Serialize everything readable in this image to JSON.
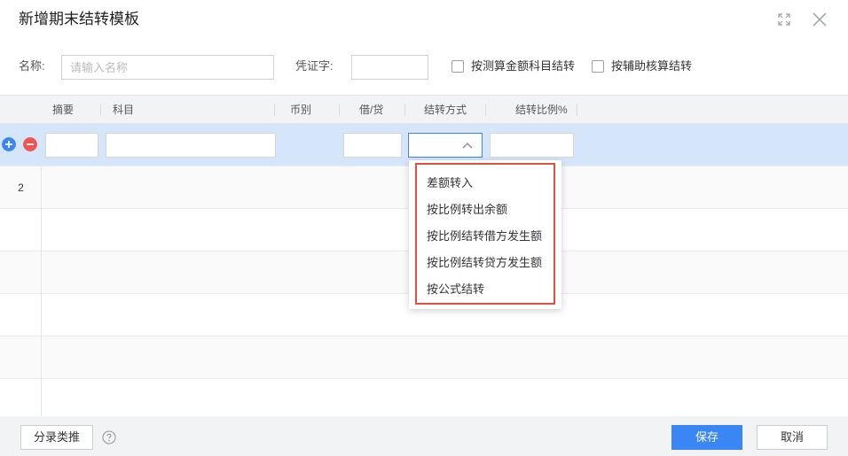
{
  "dialog": {
    "title": "新增期末结转模板",
    "expand_icon": "expand-icon",
    "close_icon": "close-icon"
  },
  "form": {
    "name_label": "名称:",
    "name_placeholder": "请输入名称",
    "name_value": "",
    "voucher_label": "凭证字:",
    "voucher_value": "",
    "check_measure_label": "按测算金额科目结转",
    "check_measure_checked": false,
    "check_aux_label": "按辅助核算结转",
    "check_aux_checked": false
  },
  "grid": {
    "columns": [
      "摘要",
      "科目",
      "币别",
      "借/贷",
      "结转方式",
      "结转比例%"
    ],
    "rows": [
      {
        "num": "",
        "selected": true
      },
      {
        "num": "2",
        "selected": false
      },
      {
        "num": "",
        "selected": false
      },
      {
        "num": "",
        "selected": false
      },
      {
        "num": "",
        "selected": false
      },
      {
        "num": "",
        "selected": false
      }
    ],
    "add_icon": "plus-circle-icon",
    "remove_icon": "minus-circle-icon"
  },
  "dropdown": {
    "options": [
      "差额转入",
      "按比例转出余额",
      "按比例结转借方发生额",
      "按比例结转贷方发生额",
      "按公式结转"
    ],
    "selected": ""
  },
  "footer": {
    "entry_button": "分录类推",
    "help_icon": "question-circle-icon",
    "save_button": "保存",
    "cancel_button": "取消"
  },
  "colors": {
    "primary": "#3a86f5",
    "selected_row": "#d5e6fa",
    "remove": "#f05454",
    "highlight_frame": "#e0503c"
  }
}
